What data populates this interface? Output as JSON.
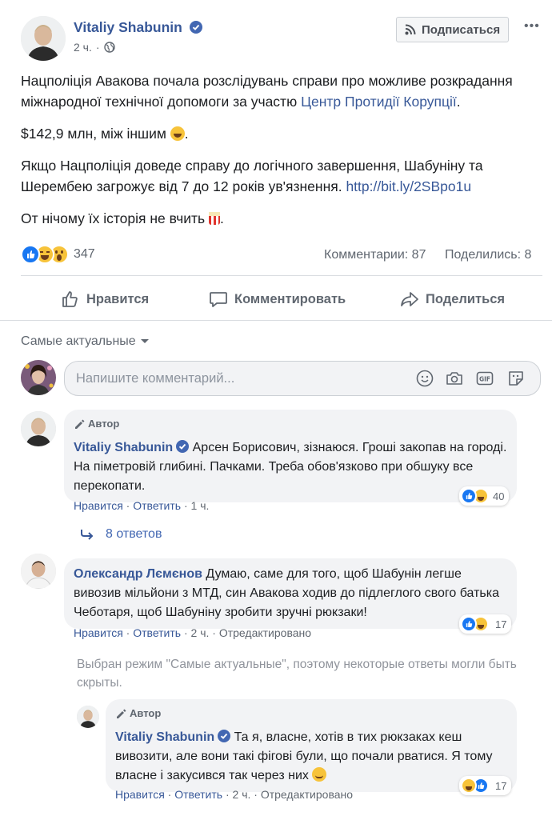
{
  "post": {
    "author": "Vitaliy Shabunin",
    "time": "2 ч.",
    "subscribe_label": "Подписаться",
    "more_label": "•••",
    "text_p1_a": "Нацполіція Авакова почала розслідувань справи про можливе розкрадання міжнародної технічної допомоги за участю ",
    "text_p1_link": "Центр Протидії Корупції",
    "text_p1_b": ".",
    "text_p2": "$142,9 млн, між іншим",
    "text_p3_a": "Якщо Нацполіція доведе справу до логічного завершення, Шабуніну та Шерембею загрожує від 7 до 12 років ув'язнення. ",
    "text_p3_link": "http://bit.ly/2SBpo1u",
    "text_p4": "От нічому їх історія не вчить",
    "reactions_count": "347",
    "comments_count": "Комментарии: 87",
    "shares_count": "Поделились: 8",
    "icons": {
      "like": "like-icon",
      "haha": "haha-icon",
      "wow": "wow-icon",
      "globe": "globe-icon",
      "rss": "rss-icon"
    }
  },
  "actions": {
    "like": "Нравится",
    "comment": "Комментировать",
    "share": "Поделиться"
  },
  "comments_section": {
    "sort_label": "Самые актуальные",
    "input_placeholder": "Напишите комментарий..."
  },
  "comments": [
    {
      "author_tag": "Автор",
      "name": "Vitaliy Shabunin",
      "text": "Арсен Борисович, зізнаюся. Гроші закопав на городі. На піметровій глибині. Пачками. Треба обов'язково при обшуку все перекопати.",
      "like": "Нравится",
      "reply": "Ответить",
      "time": "1 ч.",
      "reactions": "40",
      "replies_label": "8 ответов"
    },
    {
      "name": "Олександр Лємєнов",
      "text": "Думаю, саме для того, щоб Шабунін легше вивозив мільйони з МТД, син Авакова ходив до підлеглого свого батька Чеботаря, щоб Шабуніну зробити зручні рюкзаки!",
      "like": "Нравится",
      "reply": "Ответить",
      "time": "2 ч.",
      "edited": "Отредактировано",
      "reactions": "17"
    }
  ],
  "hidden_notice": "Выбран режим \"Самые актуальные\", поэтому некоторые ответы могли быть скрыты.",
  "reply": {
    "author_tag": "Автор",
    "name": "Vitaliy Shabunin",
    "text": "Та я, власне, хотів в тих рюкзаках кеш вивозити, але вони такі фігові були, що почали рватися. Я тому власне і закусився так через них",
    "like": "Нравится",
    "reply": "Ответить",
    "time": "2 ч.",
    "edited": "Отредактировано",
    "reactions": "17"
  },
  "colors": {
    "link": "#385898",
    "like_blue": "#1877f2",
    "emoji_yellow": "#f7c33a",
    "text": "#1c1e21",
    "muted": "#606770"
  }
}
